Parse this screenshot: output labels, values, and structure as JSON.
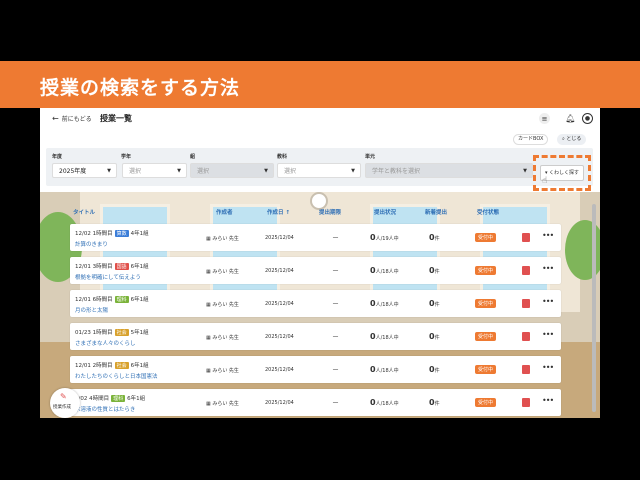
{
  "banner": {
    "title": "授業の検索をする方法"
  },
  "topbar": {
    "back_label": "前にもどる",
    "page_title": "授業一覧",
    "cardbox_label": "カードBOX",
    "close_label": "とじる"
  },
  "filters": [
    {
      "label": "年度",
      "value": "2025年度",
      "state": "value"
    },
    {
      "label": "学年",
      "value": "選択",
      "state": "enabled"
    },
    {
      "label": "組",
      "value": "選択",
      "state": "disabled"
    },
    {
      "label": "教科",
      "value": "選択",
      "state": "enabled"
    },
    {
      "label": "単元",
      "value": "学年と教科を選択",
      "state": "disabled"
    }
  ],
  "search_button": {
    "label": "くわしく探す"
  },
  "table": {
    "headers": [
      "タイトル",
      "作成者",
      "作成日",
      "提出期限",
      "提出状況",
      "新着提出",
      "受付状態"
    ],
    "rows": [
      {
        "date": "12/02 1時間目",
        "subject": "算数",
        "subject_color": "sansu",
        "class": "4年1組",
        "title": "計算のきまり",
        "author": "みらい 先生",
        "created": "2025/12/04",
        "deadline": "－",
        "status_count": "0",
        "status_total": "人/19人中",
        "new_count": "0",
        "new_unit": "件",
        "accept": "受付中"
      },
      {
        "date": "12/01 3時間目",
        "subject": "国語",
        "subject_color": "kokugo",
        "class": "6年1組",
        "title": "根拠を明確にして伝えよう",
        "author": "みらい 先生",
        "created": "2025/12/04",
        "deadline": "－",
        "status_count": "0",
        "status_total": "人/18人中",
        "new_count": "0",
        "new_unit": "件",
        "accept": "受付中"
      },
      {
        "date": "12/01 6時間目",
        "subject": "理科",
        "subject_color": "rika",
        "class": "6年1組",
        "title": "月の形と太陽",
        "author": "みらい 先生",
        "created": "2025/12/04",
        "deadline": "－",
        "status_count": "0",
        "status_total": "人/18人中",
        "new_count": "0",
        "new_unit": "件",
        "accept": "受付中"
      },
      {
        "date": "01/23 1時間目",
        "subject": "社会",
        "subject_color": "shakai",
        "class": "5年1組",
        "title": "さまざまな人々のくらし",
        "author": "みらい 先生",
        "created": "2025/12/04",
        "deadline": "－",
        "status_count": "0",
        "status_total": "人/18人中",
        "new_count": "0",
        "new_unit": "件",
        "accept": "受付中"
      },
      {
        "date": "12/01 2時間目",
        "subject": "社会",
        "subject_color": "shakai",
        "class": "6年1組",
        "title": "わたしたちのくらしと日本国憲法",
        "author": "みらい 先生",
        "created": "2025/12/04",
        "deadline": "－",
        "status_count": "0",
        "status_total": "人/18人中",
        "new_count": "0",
        "new_unit": "件",
        "accept": "受付中"
      },
      {
        "date": "2/02 4時間目",
        "subject": "理科",
        "subject_color": "rika",
        "class": "6年1組",
        "title": "水溶液の性質とはたらき",
        "author": "みらい 先生",
        "created": "2025/12/04",
        "deadline": "－",
        "status_count": "0",
        "status_total": "人/18人中",
        "new_count": "0",
        "new_unit": "件",
        "accept": "受付中"
      }
    ]
  },
  "fab": {
    "label": "授業作成"
  },
  "colors": {
    "accent": "#ee7a32",
    "link": "#2f6fb5"
  }
}
